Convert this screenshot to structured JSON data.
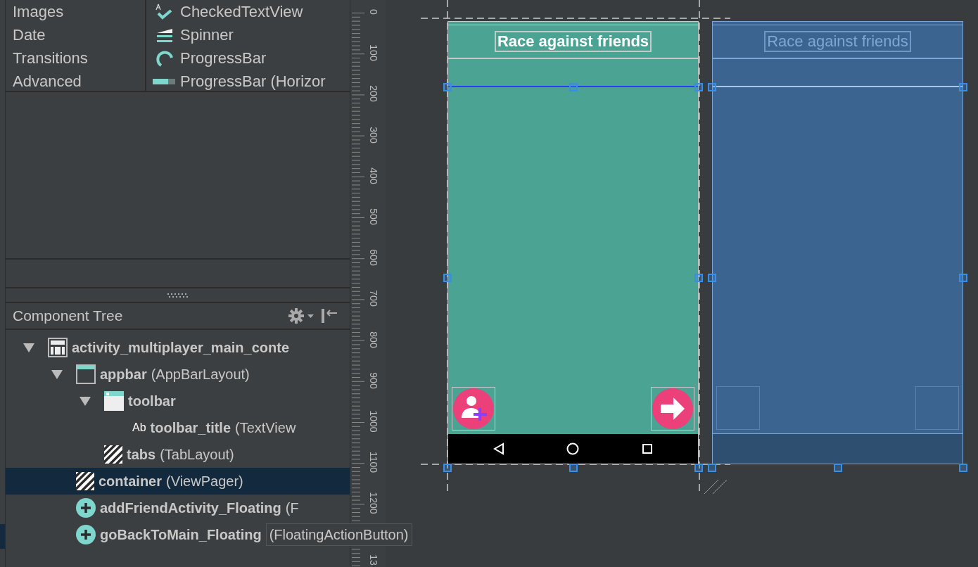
{
  "palette": {
    "categories": [
      {
        "label": "Images"
      },
      {
        "label": "Date"
      },
      {
        "label": "Transitions"
      },
      {
        "label": "Advanced"
      }
    ],
    "widgets": [
      {
        "label": "CheckedTextView",
        "kind": "checked"
      },
      {
        "label": "Spinner",
        "kind": "spinner"
      },
      {
        "label": "ProgressBar",
        "kind": "progress"
      },
      {
        "label": "ProgressBar (Horizor",
        "kind": "progress_h"
      }
    ]
  },
  "component_tree": {
    "title": "Component Tree",
    "items": [
      {
        "name": "activity_multiplayer_main_conte",
        "kind": "layout",
        "expanded": true,
        "selected": false,
        "children": [
          {
            "name": "appbar",
            "type": "(AppBarLayout)",
            "kind": "appbar",
            "expanded": true,
            "selected": false,
            "children": [
              {
                "name": "toolbar",
                "kind": "toolbar",
                "expanded": true,
                "selected": false,
                "children": [
                  {
                    "name": "toolbar_title",
                    "type": "(TextView",
                    "kind": "text",
                    "icon_text": "Ab",
                    "selected": false
                  }
                ]
              },
              {
                "name": "tabs",
                "type": "(TabLayout)",
                "kind": "tabs",
                "selected": false
              }
            ]
          },
          {
            "name": "container",
            "type": "(ViewPager)",
            "kind": "tabs",
            "selected": true
          },
          {
            "name": "addFriendActivity_Floating",
            "type": "(F",
            "kind": "fab",
            "selected": false
          },
          {
            "name": "goBackToMain_Floating",
            "type": "(FloatingActionButton)",
            "kind": "fab",
            "selected": false,
            "tooltip": true
          }
        ]
      }
    ]
  },
  "ruler": {
    "labels": [
      "0",
      "100",
      "200",
      "300",
      "400",
      "500",
      "600",
      "700",
      "800",
      "900",
      "1000",
      "1100",
      "1200",
      "13"
    ]
  },
  "design": {
    "toolbar_title": "Race against friends"
  },
  "blueprint": {
    "toolbar_title": "Race against friends"
  }
}
